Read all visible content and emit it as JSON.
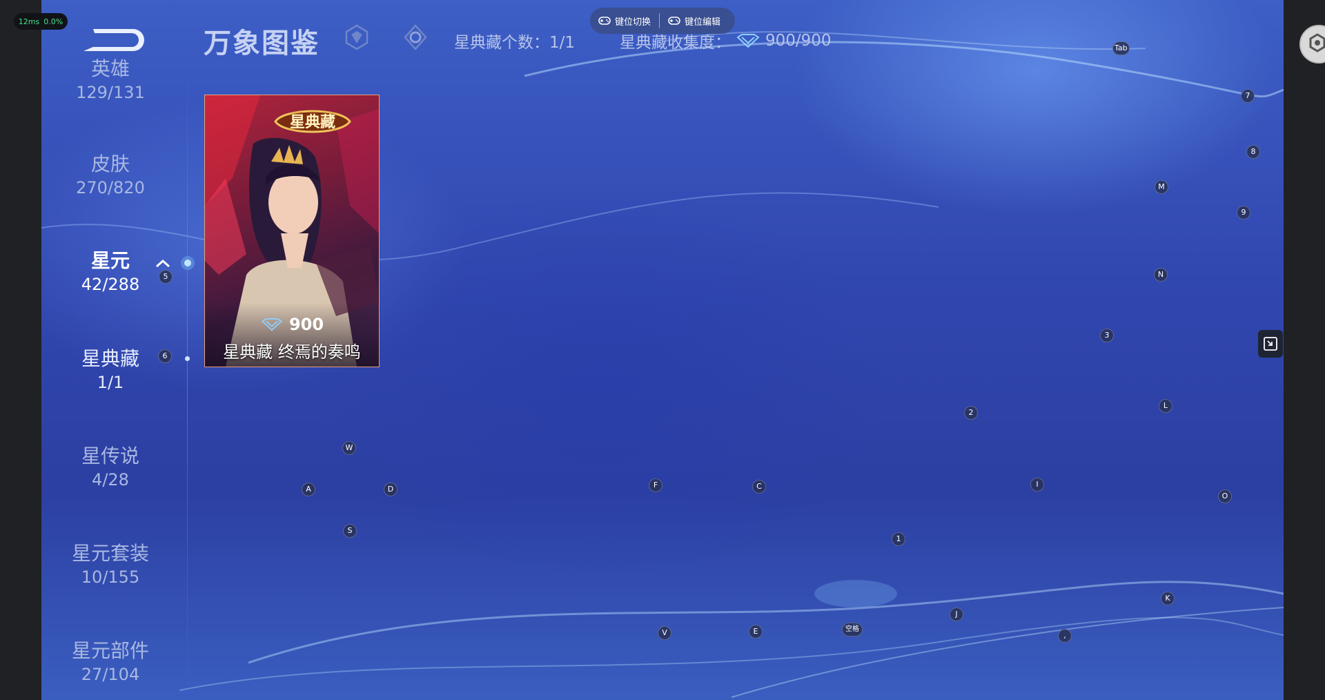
{
  "perf": {
    "latency": "12ms",
    "loss": "0.0%"
  },
  "toolbar": {
    "switch_label": "键位切换",
    "edit_label": "键位编辑"
  },
  "header": {
    "title": "万象图鉴",
    "count_label": "星典藏个数：1/1",
    "collect_label": "星典藏收集度：",
    "collect_value": "900/900"
  },
  "sidebar": {
    "items": [
      {
        "label": "英雄",
        "count": "129/131"
      },
      {
        "label": "皮肤",
        "count": "270/820"
      },
      {
        "label": "星元",
        "count": "42/288"
      },
      {
        "label": "星典藏",
        "count": "1/1"
      },
      {
        "label": "星传说",
        "count": "4/28"
      },
      {
        "label": "星元套装",
        "count": "10/155"
      },
      {
        "label": "星元部件",
        "count": "27/104"
      }
    ]
  },
  "card": {
    "badge": "星典藏",
    "price": "900",
    "name": "星典藏  终焉的奏鸣"
  },
  "key_hints": {
    "tab": "Tab",
    "k7": "7",
    "k8": "8",
    "km": "M",
    "k9": "9",
    "kn": "N",
    "k3": "3",
    "k5": "5",
    "k6": "6",
    "kl": "L",
    "k2": "2",
    "kw": "W",
    "ka": "A",
    "kd": "D",
    "kf": "F",
    "kc": "C",
    "ki": "I",
    "ko": "O",
    "ks": "S",
    "k1": "1",
    "kk": "K",
    "kj": "J",
    "kv": "V",
    "ke": "E",
    "kspace": "空格",
    "kcomma": ","
  },
  "colors": {
    "accent": "#8fd0ff",
    "card_border": "#e6a07a",
    "perf_green": "#4be08a"
  }
}
